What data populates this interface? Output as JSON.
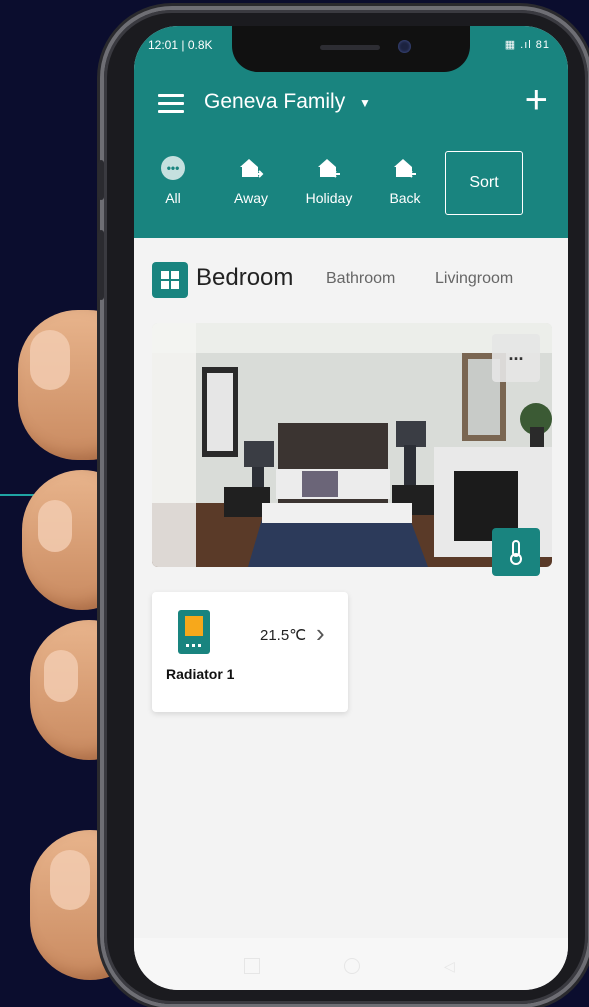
{
  "status": {
    "time": "12:01 | 0.8K",
    "indicators": "▦ .ıl 81"
  },
  "header": {
    "family_name": "Geneva Family"
  },
  "scenes": [
    {
      "label": "All",
      "icon": "more-circle-icon"
    },
    {
      "label": "Away",
      "icon": "home-leave-icon"
    },
    {
      "label": "Holiday",
      "icon": "home-return-icon"
    },
    {
      "label": "Back",
      "icon": "home-return-icon"
    }
  ],
  "sort_label": "Sort",
  "rooms": {
    "active": "Bedroom",
    "tabs": [
      "Bathroom",
      "Livingroom"
    ]
  },
  "room_card": {
    "more_label": "..."
  },
  "device": {
    "name": "Radiator 1",
    "temperature": "21.5℃"
  },
  "colors": {
    "accent": "#19847f",
    "background": "#0b0d2e"
  }
}
